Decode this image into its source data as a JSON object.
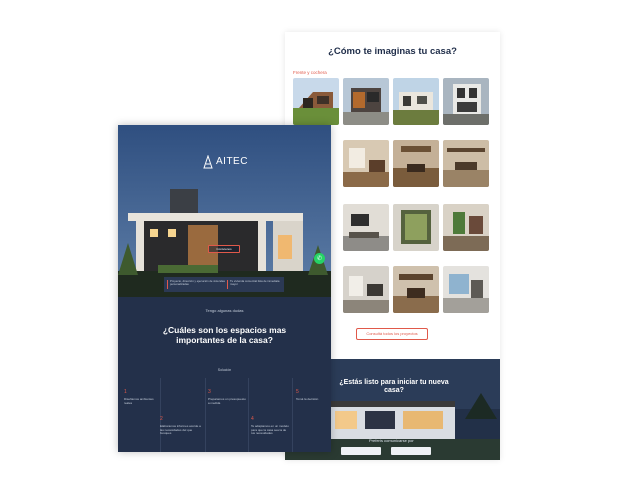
{
  "back_page": {
    "title": "¿Cómo te imaginas tu casa?",
    "section_label": "Frente y cochera",
    "button_label": "Consultá todos los proyectos",
    "cta_title": "¿Estás listo para iniciar tu nueva casa?",
    "cta_sub": "Preferís comunicarse por"
  },
  "front_page": {
    "logo_text": "AITEC",
    "logo_sub": "",
    "hero_button": "Conócenos",
    "features": [
      "Proyecto, dirección y ejecución de viviendas personalizadas",
      "Tu vivienda comercial lista de inmediata mayor"
    ],
    "intro": "Tengo algunas dudas",
    "question": "¿Cuáles son los espacios mas importantes de la casa?",
    "solution_label": "Solución",
    "steps": [
      {
        "num": "1",
        "text": "Diseñamos ambientes reales"
      },
      {
        "num": "2",
        "text": "Elaboramos informes acorde a las necesidades del que busques"
      },
      {
        "num": "3",
        "text": "Preparamos un presupuesto a medida"
      },
      {
        "num": "4",
        "text": "Te adaptamos en un modelo para que la casa sea la de tus necesidades"
      },
      {
        "num": "5",
        "text": "Tomá la decisión"
      }
    ]
  },
  "colors": {
    "navy": "#23304a",
    "accent": "#e0594a",
    "title": "#1f2d49",
    "whatsapp": "#25d366"
  },
  "icons": {
    "logo": "aitec-logo-icon",
    "whatsapp": "whatsapp-icon"
  }
}
